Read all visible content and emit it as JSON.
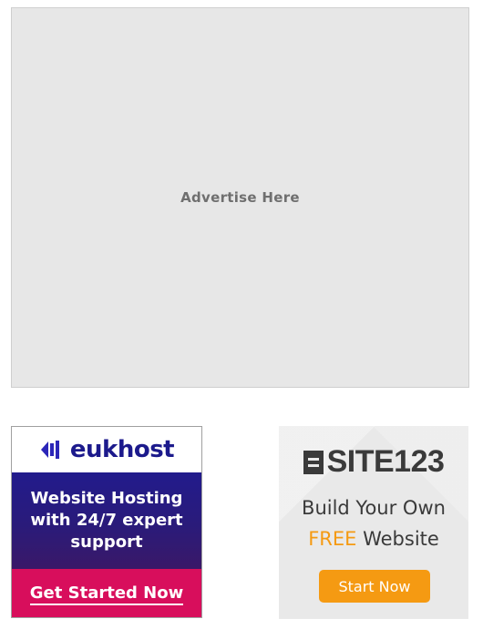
{
  "main_ad": {
    "label": "Advertise Here"
  },
  "eukhost_ad": {
    "brand": "eukhost",
    "headline": "Website Hosting with 24/7 expert support",
    "cta_label": "Get Started Now",
    "icon": "eukhost-logo-icon",
    "colors": {
      "brand_blue": "#1c1a8c",
      "cta_pink": "#d80e5c"
    }
  },
  "site123_ad": {
    "brand": "SITE123",
    "line1": "Build Your Own",
    "line2_highlight": "FREE",
    "line2_rest": "Website",
    "button_label": "Start Now",
    "icon": "site123-logo-icon",
    "colors": {
      "accent_orange": "#f59a12",
      "text_dark": "#3a3a3a"
    }
  }
}
